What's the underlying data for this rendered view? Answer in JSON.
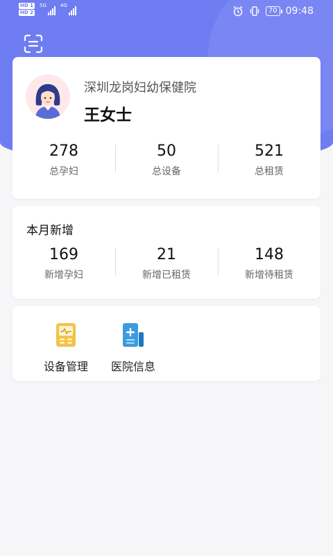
{
  "status_bar": {
    "hd1": "HD 1",
    "hd2": "HD 2",
    "sim1_net": "5G",
    "sim2_net": "4G",
    "battery": "70",
    "time": "09:48"
  },
  "profile": {
    "hospital": "深圳龙岗妇幼保健院",
    "name": "王女士"
  },
  "totals": [
    {
      "value": "278",
      "label": "总孕妇"
    },
    {
      "value": "50",
      "label": "总设备"
    },
    {
      "value": "521",
      "label": "总租赁"
    }
  ],
  "monthly": {
    "title": "本月新增",
    "stats": [
      {
        "value": "169",
        "label": "新增孕妇"
      },
      {
        "value": "21",
        "label": "新增已租赁"
      },
      {
        "value": "148",
        "label": "新增待租赁"
      }
    ]
  },
  "functions": [
    {
      "label": "设备管理",
      "icon": "device-management-icon"
    },
    {
      "label": "医院信息",
      "icon": "hospital-info-icon"
    }
  ],
  "colors": {
    "primary": "#6f7df3",
    "background": "#f6f6f8",
    "device_icon": "#f2c34a",
    "hospital_icon": "#3a9be0"
  }
}
